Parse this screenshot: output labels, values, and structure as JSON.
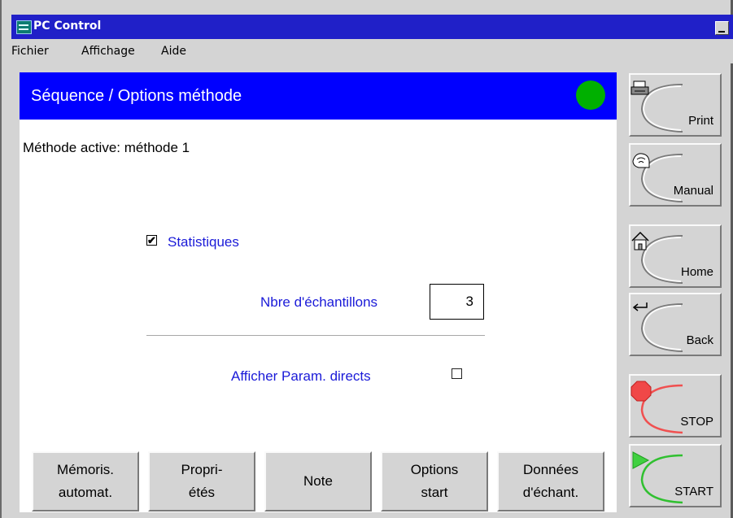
{
  "window": {
    "title": "PC Control"
  },
  "menu": [
    "Fichier",
    "Affichage",
    "Aide"
  ],
  "header": {
    "title": "Séquence / Options méthode",
    "status_color": "#00b000"
  },
  "content": {
    "method_active": "Méthode active: méthode 1",
    "statistics": {
      "label": "Statistiques",
      "checked": true,
      "check_glyph": "✔"
    },
    "sample_count": {
      "label": "Nbre d'échantillons",
      "value": "3"
    },
    "show_direct_params": {
      "label": "Afficher Param. directs",
      "checked": false
    }
  },
  "bottom_buttons": [
    {
      "label": "Mémoris.\nautomat."
    },
    {
      "label": "Propri-\nétés"
    },
    {
      "label": "Note"
    },
    {
      "label": "Options\nstart"
    },
    {
      "label": "Données\nd'échant."
    }
  ],
  "side_buttons": {
    "print": {
      "label": "Print",
      "icon": "printer-icon"
    },
    "manual": {
      "label": "Manual",
      "icon": "manual-icon"
    },
    "home": {
      "label": "Home",
      "icon": "house-icon"
    },
    "back": {
      "label": "Back",
      "icon": "back-arrow-icon"
    },
    "stop": {
      "label": "STOP",
      "icon": "stop-octagon-icon",
      "accent": "#f05050"
    },
    "start": {
      "label": "START",
      "icon": "play-triangle-icon",
      "accent": "#30c030"
    }
  }
}
